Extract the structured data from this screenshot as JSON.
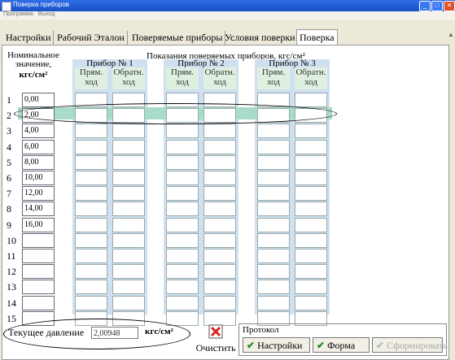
{
  "window": {
    "title": "Поверка приборов"
  },
  "menu": [
    "Программа",
    "Выход"
  ],
  "tabs": [
    "Настройки",
    "Рабочий Эталон",
    "Поверяемые приборы",
    "Условия поверки",
    "Поверка"
  ],
  "nominal": {
    "line1": "Номинальное",
    "line2": "значение,",
    "unit": "кгс/см²"
  },
  "readings_header": "Показания поверяемых приборов,   кгс/см²",
  "devices": [
    {
      "title": "Прибор № 1",
      "forward": "Прям. ход",
      "reverse": "Обратн. ход"
    },
    {
      "title": "Прибор № 2",
      "forward": "Прям. ход",
      "reverse": "Обратн. ход"
    },
    {
      "title": "Прибор № 3",
      "forward": "Прям. ход",
      "reverse": "Обратн. ход"
    }
  ],
  "rows": [
    {
      "n": "1",
      "value": "0,00"
    },
    {
      "n": "2",
      "value": "2,00"
    },
    {
      "n": "3",
      "value": "4,00"
    },
    {
      "n": "4",
      "value": "6,00"
    },
    {
      "n": "5",
      "value": "8,00"
    },
    {
      "n": "6",
      "value": "10,00"
    },
    {
      "n": "7",
      "value": "12,00"
    },
    {
      "n": "8",
      "value": "14,00"
    },
    {
      "n": "9",
      "value": "16,00"
    },
    {
      "n": "10",
      "value": ""
    },
    {
      "n": "11",
      "value": ""
    },
    {
      "n": "12",
      "value": ""
    },
    {
      "n": "13",
      "value": ""
    },
    {
      "n": "14",
      "value": ""
    },
    {
      "n": "15",
      "value": ""
    }
  ],
  "current_pressure": {
    "label": "Текущее давление",
    "value": "2,00948",
    "unit": "кгс/см²"
  },
  "clear_button": "Очистить",
  "protocol": {
    "title": "Протокол",
    "settings_button": "Настройки",
    "form_button": "Форма",
    "generate_button": "Сформировать"
  },
  "highlight_color": "#a8dcc8",
  "group_color": "#cfe0f1"
}
